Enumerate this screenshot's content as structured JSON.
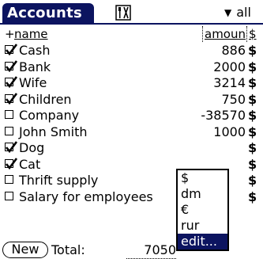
{
  "title": "Accounts",
  "filter": {
    "value": "all"
  },
  "header": {
    "add": "+",
    "name": "name",
    "amount": "amoun",
    "currency": "$"
  },
  "accounts": [
    {
      "name": "Cash",
      "checked": true,
      "amount": "886",
      "currency": "$"
    },
    {
      "name": "Bank",
      "checked": true,
      "amount": "2000",
      "currency": "$"
    },
    {
      "name": "Wife",
      "checked": true,
      "amount": "3214",
      "currency": "$"
    },
    {
      "name": "Children",
      "checked": true,
      "amount": "750",
      "currency": "$"
    },
    {
      "name": "Company",
      "checked": false,
      "amount": "-38570",
      "currency": "$"
    },
    {
      "name": "John Smith",
      "checked": false,
      "amount": "1000",
      "currency": "$"
    },
    {
      "name": "Dog",
      "checked": true,
      "amount": "",
      "currency": "$"
    },
    {
      "name": "Cat",
      "checked": true,
      "amount": "",
      "currency": "$"
    },
    {
      "name": "Thrift supply",
      "checked": false,
      "amount": "",
      "currency": "$"
    },
    {
      "name": "Salary for employees",
      "checked": false,
      "amount": "",
      "currency": "$"
    }
  ],
  "currency_popup": {
    "options": [
      "$",
      "dm",
      "€",
      "rur",
      "edit..."
    ],
    "selected_index": 4
  },
  "footer": {
    "new_label": "New",
    "total_label": "Total:",
    "total_value": "7050"
  },
  "colors": {
    "accent": "#0c1460"
  }
}
